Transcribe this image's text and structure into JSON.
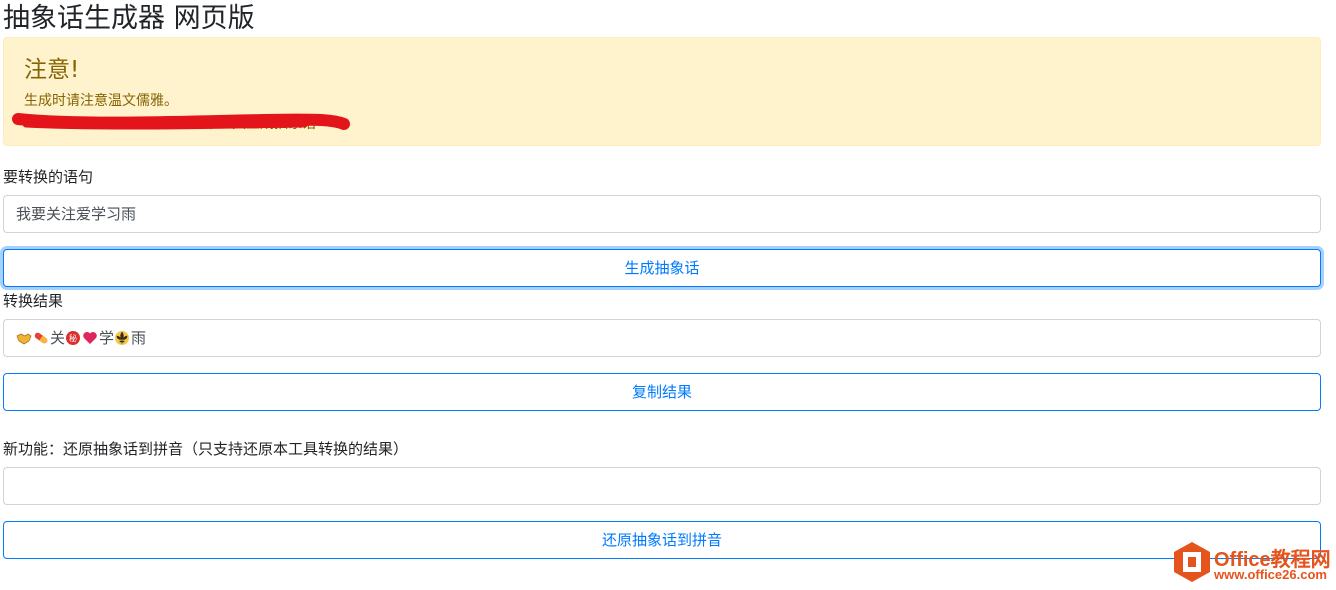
{
  "page": {
    "title": "抽象话生成器 网页版"
  },
  "alert": {
    "heading": "注意!",
    "line1": "生成时请注意温文儒雅。",
    "line2_partial": "本工具生成抽象话"
  },
  "convert": {
    "label": "要转换的语句",
    "input_value": "我要关注爱学习雨",
    "button_label": "生成抽象话"
  },
  "result": {
    "label": "转换结果",
    "tokens": [
      {
        "type": "icon",
        "name": "handshake-emoji-icon"
      },
      {
        "type": "icon",
        "name": "pill-emoji-icon"
      },
      {
        "type": "text",
        "text": "关"
      },
      {
        "type": "icon",
        "name": "secret-badge-emoji-icon"
      },
      {
        "type": "icon",
        "name": "red-heart-emoji-icon"
      },
      {
        "type": "text",
        "text": "学"
      },
      {
        "type": "icon",
        "name": "fleur-de-lis-emoji-icon"
      },
      {
        "type": "text",
        "text": "雨"
      }
    ],
    "copy_button_label": "复制结果"
  },
  "restore": {
    "label": "新功能：还原抽象话到拼音（只支持还原本工具转换的结果）",
    "input_value": "",
    "button_label": "还原抽象话到拼音"
  },
  "watermark": {
    "name": "Office教程网",
    "url": "www.office26.com"
  },
  "colors": {
    "primary": "#007bff",
    "alert_bg": "#fff3cd",
    "alert_text": "#856404",
    "scribble": "#e3151a",
    "watermark": "#e5541d"
  }
}
